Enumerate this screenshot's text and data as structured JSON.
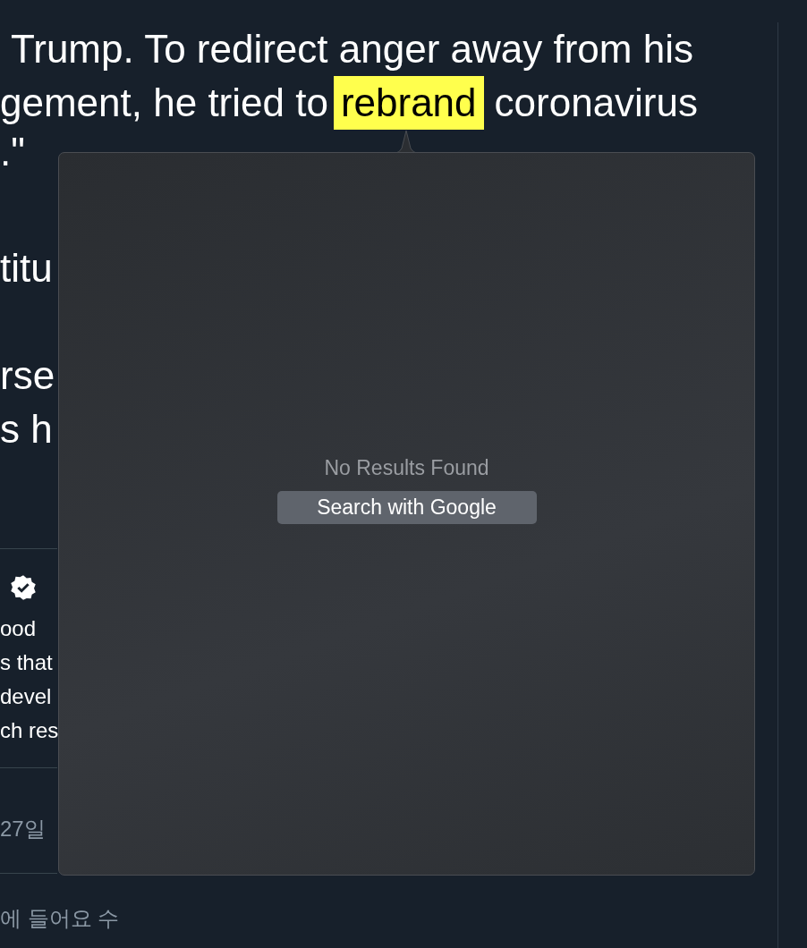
{
  "article": {
    "lines": [
      {
        "segments": [
          {
            "text": "Trump. To redirect anger away from his",
            "highlighted": false
          }
        ]
      },
      {
        "segments": [
          {
            "text": "gement, he tried to",
            "highlighted": false
          },
          {
            "text": "rebrand",
            "highlighted": true
          },
          {
            "text": "coronavirus",
            "highlighted": false
          }
        ]
      },
      {
        "segments": [
          {
            "text": ".\"",
            "highlighted": false
          }
        ]
      },
      {
        "segments": [
          {
            "text": "titu",
            "highlighted": false
          }
        ]
      },
      {
        "segments": [
          {
            "text": "rse",
            "highlighted": false
          }
        ]
      },
      {
        "segments": [
          {
            "text": "s h",
            "highlighted": false
          }
        ]
      }
    ]
  },
  "embedded_tweet": {
    "verified": true,
    "lines": [
      "ood",
      "s that",
      "devel",
      "ch res"
    ]
  },
  "date": "27일",
  "footer": "에 들어요 수",
  "lookup_popup": {
    "message": "No Results Found",
    "button": "Search with Google"
  }
}
